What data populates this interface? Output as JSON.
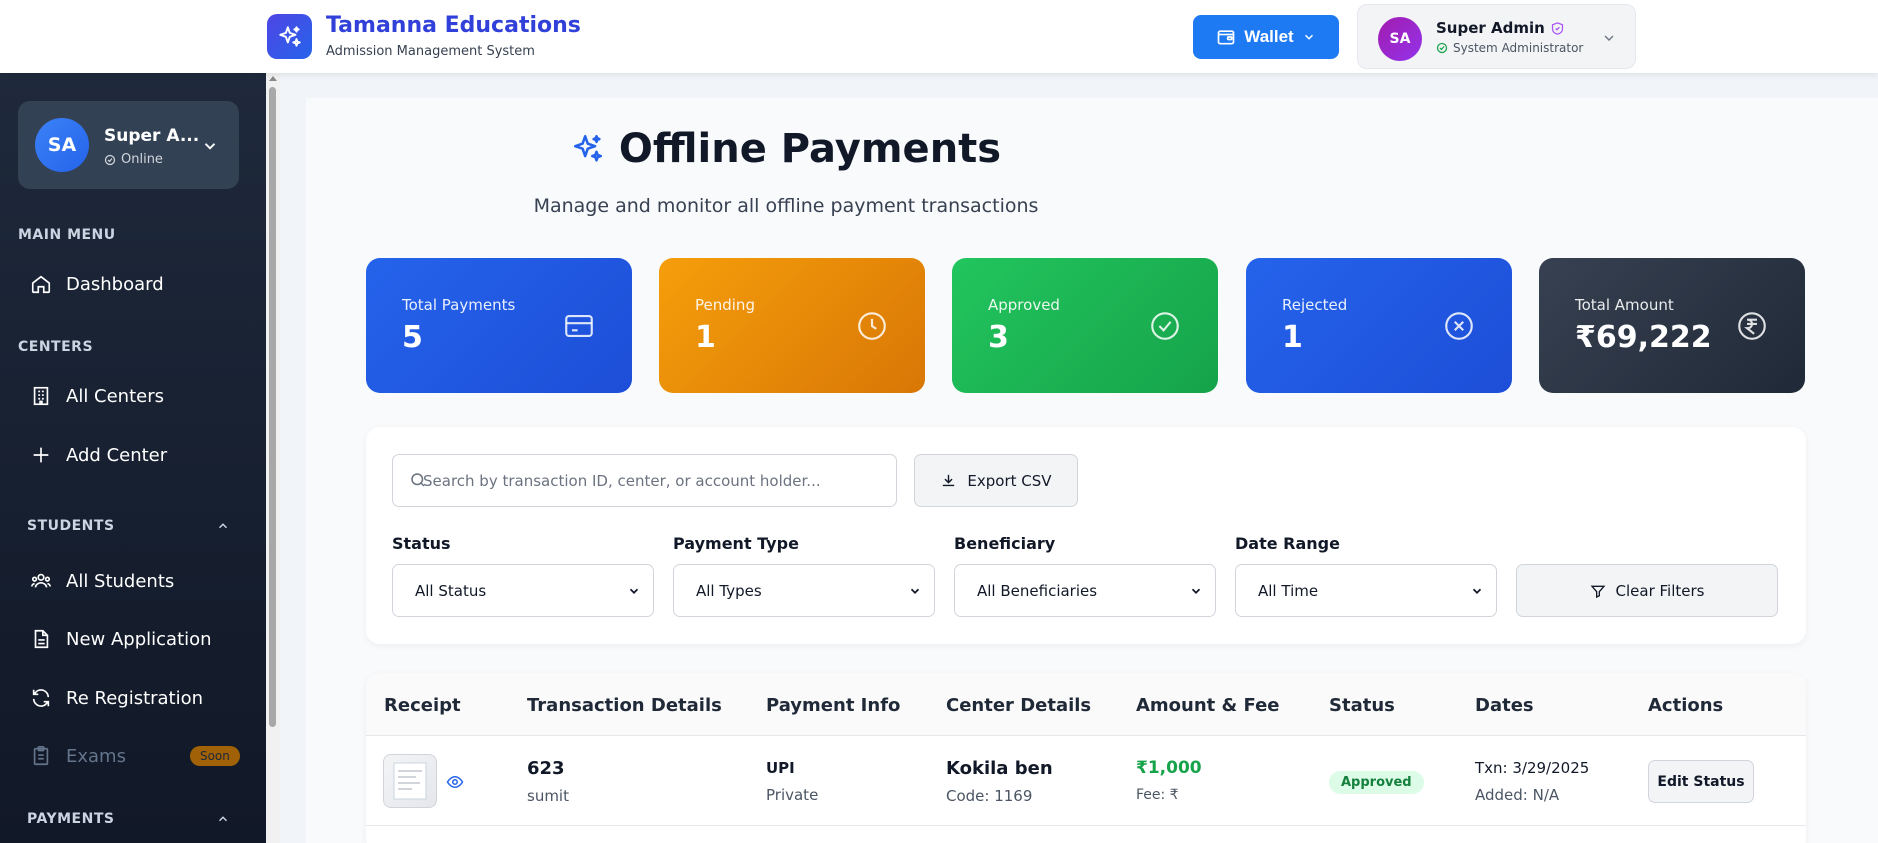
{
  "header": {
    "brand_name": "Tamanna Educations",
    "brand_subtitle": "Admission Management System",
    "wallet_label": "Wallet",
    "user_initials": "SA",
    "user_name": "Super Admin",
    "user_role": "System Administrator"
  },
  "sidebar": {
    "user_initials": "SA",
    "user_name": "Super A...",
    "user_status": "Online",
    "sections": {
      "main_menu": "MAIN MENU",
      "centers": "CENTERS",
      "students": "STUDENTS",
      "payments": "PAYMENTS"
    },
    "items": {
      "dashboard": "Dashboard",
      "all_centers": "All Centers",
      "add_center": "Add Center",
      "all_students": "All Students",
      "new_application": "New Application",
      "re_registration": "Re Registration",
      "exams": "Exams",
      "exams_badge": "Soon"
    }
  },
  "page": {
    "title": "Offline Payments",
    "subtitle": "Manage and monitor all offline payment transactions"
  },
  "stats": [
    {
      "label": "Total Payments",
      "value": "5",
      "icon": "credit-card-icon",
      "color": "#1d4ed8"
    },
    {
      "label": "Pending",
      "value": "1",
      "icon": "clock-icon",
      "color": "#e07a06"
    },
    {
      "label": "Approved",
      "value": "3",
      "icon": "check-circle-icon",
      "color": "#16a34a"
    },
    {
      "label": "Rejected",
      "value": "1",
      "icon": "x-circle-icon",
      "color": "#1d4ed8"
    },
    {
      "label": "Total Amount",
      "value": "₹69,222",
      "icon": "rupee-circle-icon",
      "color": "#1f2937"
    }
  ],
  "filters": {
    "search_placeholder": "Search by transaction ID, center, or account holder...",
    "export_label": "Export CSV",
    "status_label": "Status",
    "status_value": "All Status",
    "type_label": "Payment Type",
    "type_value": "All Types",
    "beneficiary_label": "Beneficiary",
    "beneficiary_value": "All Beneficiaries",
    "date_label": "Date Range",
    "date_value": "All Time",
    "clear_label": "Clear Filters"
  },
  "table": {
    "columns": [
      "Receipt",
      "Transaction Details",
      "Payment Info",
      "Center Details",
      "Amount & Fee",
      "Status",
      "Dates",
      "Actions"
    ],
    "rows": [
      {
        "txn_id": "623",
        "txn_name": "sumit",
        "pay_method": "UPI",
        "pay_type": "Private",
        "center_name": "Kokila ben",
        "center_code": "Code: 1169",
        "amount": "₹1,000",
        "fee": "Fee: ₹",
        "status": "Approved",
        "txn_date": "Txn: 3/29/2025",
        "added_date": "Added: N/A",
        "action": "Edit Status"
      }
    ]
  }
}
